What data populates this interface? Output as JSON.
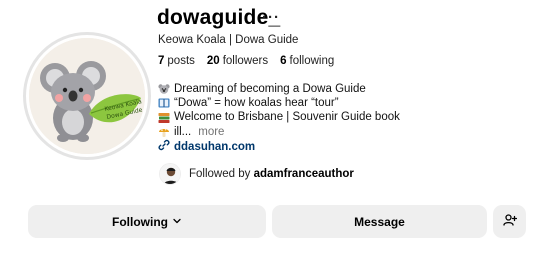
{
  "profile": {
    "username": "dowaguide_",
    "more_label": "···",
    "full_name": "Keowa Koala | Dowa Guide",
    "avatar_leaf_text": "Keowa Koala Dowa Guide"
  },
  "stats": {
    "posts": {
      "count": "7",
      "label": "posts"
    },
    "followers": {
      "count": "20",
      "label": "followers"
    },
    "following": {
      "count": "6",
      "label": "following"
    }
  },
  "bio": {
    "lines": [
      {
        "icon": "koala-icon",
        "text": "Dreaming of becoming a Dowa Guide"
      },
      {
        "icon": "book-icon",
        "text": "“Dowa” = how koalas hear “tour”"
      },
      {
        "icon": "books-icon",
        "text": "Welcome to Brisbane | Souvenir Guide book"
      },
      {
        "icon": "mushroom-icon",
        "text": "ill..."
      }
    ],
    "more_label": "more"
  },
  "link": {
    "icon": "link-icon",
    "text": "ddasuhan.com"
  },
  "followed_by": {
    "prefix": "Followed by",
    "name": "adamfranceauthor"
  },
  "actions": {
    "following_label": "Following",
    "message_label": "Message",
    "add_user_icon": "add-user-icon"
  },
  "colors": {
    "link": "#00376b",
    "button_bg": "#efefef",
    "muted": "#737373",
    "leaf": "#8cc63f"
  }
}
